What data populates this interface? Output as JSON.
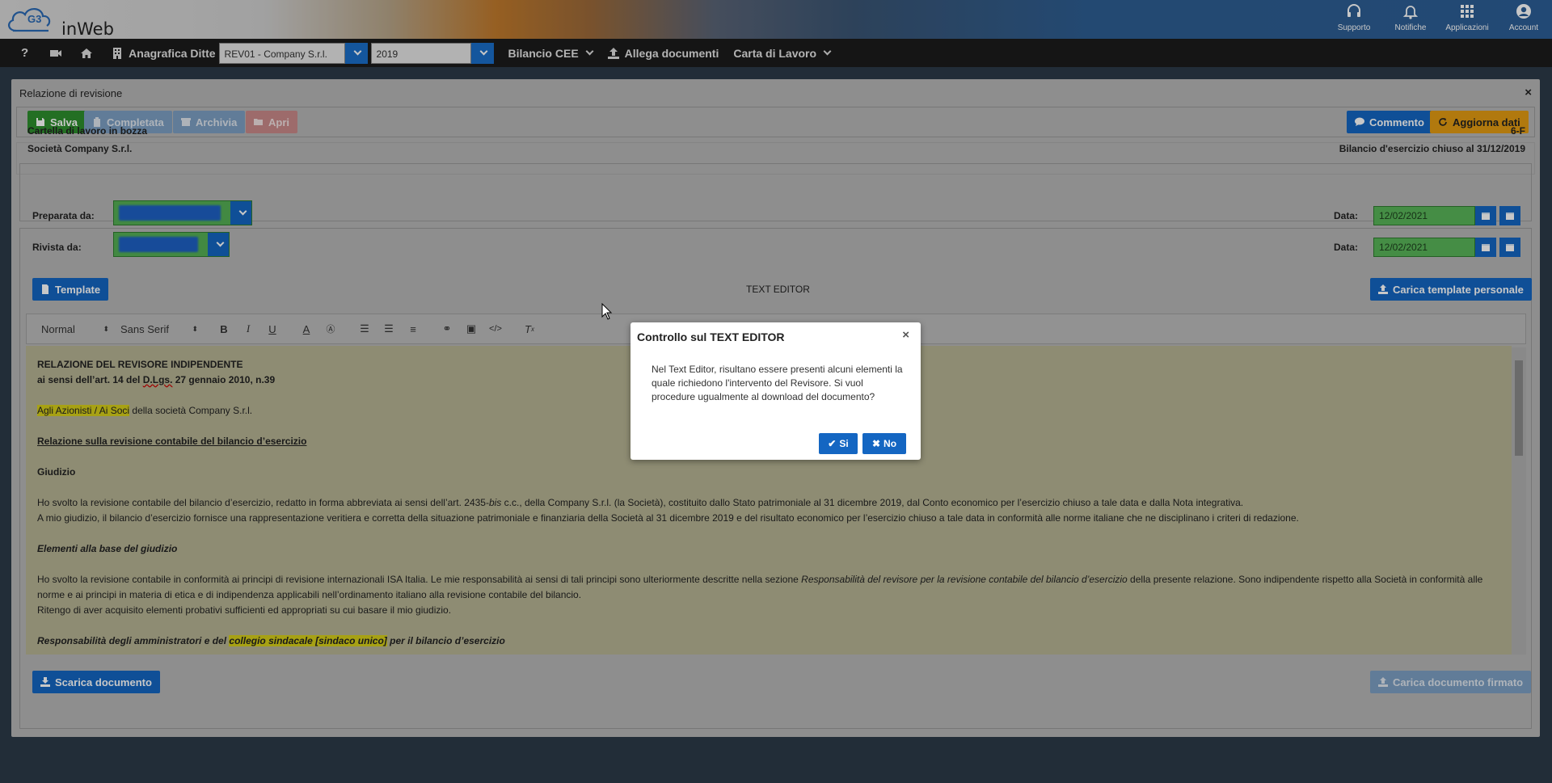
{
  "header": {
    "brand": "inWeb",
    "logo_letters": "G3",
    "icons": [
      {
        "icon": "headset-icon",
        "label": "Supporto"
      },
      {
        "icon": "bell-icon",
        "label": "Notifiche"
      },
      {
        "icon": "grid-icon",
        "label": "Applicazioni"
      },
      {
        "icon": "account-icon",
        "label": "Account"
      }
    ]
  },
  "menubar": {
    "help": "?",
    "anagrafica": "Anagrafica Ditte",
    "company_value": "REV01 - Company S.r.l.",
    "year_value": "2019",
    "bilancio": "Bilancio CEE",
    "allega": "Allega documenti",
    "carta": "Carta di Lavoro"
  },
  "panel": {
    "title": "Relazione di revisione",
    "close": "×",
    "buttons": {
      "salva": "Salva",
      "completata": "Completata",
      "archivia": "Archivia",
      "apri": "Apri",
      "commento": "Commento",
      "aggiorna": "Aggiorna dati"
    },
    "info": {
      "status": "Cartella di lavoro in bozza",
      "company": "Società Company S.r.l.",
      "code": "6-F",
      "period": "Bilancio d'esercizio chiuso al 31/12/2019"
    },
    "preparata_label": "Preparata da:",
    "rivista_label": "Rivista da:",
    "data_label": "Data:",
    "date_prep": "12/02/2021",
    "date_riv": "12/02/2021",
    "template_btn": "Template",
    "editor_title": "TEXT EDITOR",
    "carica_template": "Carica template personale",
    "scarica": "Scarica documento",
    "carica_firmato": "Carica documento firmato"
  },
  "toolbar": {
    "format": "Normal",
    "font": "Sans Serif"
  },
  "document": {
    "h1": "RELAZIONE DEL REVISORE INDIPENDENTE",
    "h2_pre": "ai sensi dell’art. 14 del ",
    "h2_dlgs": "D.Lgs.",
    "h2_post": " 27 gennaio 2010, n.39",
    "addressee_hl": "Agli Azionisti / Ai Soci",
    "addressee_rest": " della società Company S.r.l.",
    "section1": "Relazione sulla revisione contabile del bilancio d’esercizio",
    "giudizio": "Giudizio",
    "p1_a": "Ho svolto la revisione contabile del bilancio d’esercizio, redatto in forma abbreviata ai sensi dell’art. 2435-",
    "p1_bis": "bis",
    "p1_b": " c.c., della Company S.r.l. (la Società), costituito dallo Stato patrimoniale al 31 dicembre 2019, dal Conto economico per l’esercizio chiuso a tale data e dalla Nota integrativa.",
    "p2": "A mio giudizio, il bilancio d’esercizio fornisce una rappresentazione veritiera e corretta della situazione patrimoniale e finanziaria della Società al 31 dicembre 2019 e del risultato economico per l’esercizio chiuso a tale data in conformità alle norme italiane che ne disciplinano i criteri di redazione.",
    "elementi": "Elementi alla base del giudizio",
    "p3_a": "Ho svolto la revisione contabile in conformità ai principi di revisione internazionali ISA Italia. Le mie responsabilità ai sensi di tali principi sono ulteriormente descritte nella sezione ",
    "p3_it": "Responsabilità del revisore per la revisione contabile del bilancio d’esercizio",
    "p3_b": " della presente relazione. Sono indipendente rispetto alla Società in conformità alle norme e ai principi in materia di etica e di indipendenza applicabili nell’ordinamento italiano alla revisione contabile del bilancio.",
    "p4": "Ritengo di aver acquisito elementi probativi sufficienti ed appropriati su cui basare il mio giudizio.",
    "resp_a": "Responsabilità degli amministratori e del ",
    "resp_hl": "collegio sindacale [sindaco unico]",
    "resp_b": " per il bilancio d’esercizio"
  },
  "modal": {
    "title": "Controllo sul TEXT EDITOR",
    "close": "×",
    "body": "Nel Text Editor, risultano essere presenti alcuni elementi la quale richiedono l'intervento del Revisore. Si vuol procedure ugualmente al download del documento?",
    "yes": "Si",
    "no": "No"
  }
}
